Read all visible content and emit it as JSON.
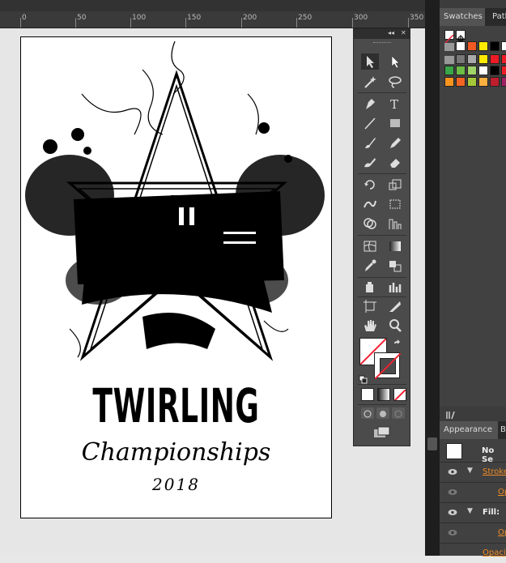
{
  "ruler": {
    "labels": [
      "0",
      "50",
      "100",
      "150",
      "200",
      "250",
      "300",
      "350"
    ]
  },
  "artboard": {
    "title_main": "TWIRLING",
    "title_sub": "Championships",
    "year": "2018"
  },
  "tools_panel": {
    "collapse_glyph": "◂◂",
    "close_glyph": "✕"
  },
  "swatches_panel": {
    "tab_active": "Swatches",
    "tab_other": "Path"
  },
  "appearance_panel": {
    "tab_active": "Appearance",
    "tab_other": "B",
    "selection_label": "No Se",
    "stroke_label": "Stroke",
    "stroke_opacity": "Op",
    "fill_label": "Fill:",
    "fill_opacity": "Op",
    "opacity_label": "Opaci"
  },
  "colors": {
    "accent_orange": "#f08a24",
    "panel_bg": "#3c3c3c",
    "toolbar_bg": "#4b4b4b"
  }
}
